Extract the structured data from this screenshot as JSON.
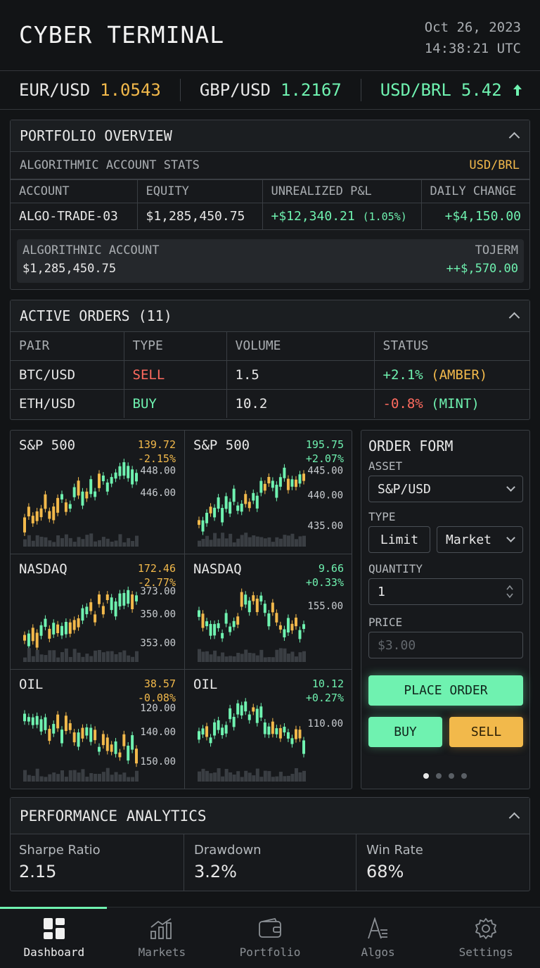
{
  "header": {
    "title": "CYBER TERMINAL",
    "date": "Oct 26, 2023",
    "time": "14:38:21 UTC"
  },
  "ticker": [
    {
      "pair": "EUR/USD",
      "value": "1.0543",
      "color": "#f2b94b"
    },
    {
      "pair": "GBP/USD",
      "value": "1.2167",
      "color": "#6ff2b0"
    },
    {
      "pair": "USD/BRL",
      "value": "5.42",
      "color": "#6ff2b0",
      "arrow": "arrow-up-icon"
    }
  ],
  "portfolio": {
    "title": "PORTFOLIO OVERVIEW",
    "subtitle": "ALGORITHMIC ACCOUNT STATS",
    "subtitle_right": "USD/BRL",
    "columns": [
      "ACCOUNT",
      "EQUITY",
      "UNREALIZED P&L",
      "DAILY CHANGE"
    ],
    "row": {
      "account": "ALGO-TRADE-03",
      "equity": "$1,285,450.75",
      "pnl": "+$12,340.21",
      "pnl_pct": "(1.05%)",
      "daily": "+$4,150.00"
    },
    "card": {
      "label": "ALGORITHNIC ACCOUNT",
      "value": "$1,285,450.75",
      "right_label": "TOJERM",
      "right_value": "++$,570.00"
    }
  },
  "orders": {
    "title": "ACTIVE ORDERS (11)",
    "columns": [
      "PAIR",
      "TYPE",
      "VOLUME",
      "STATUS"
    ],
    "rows": [
      {
        "pair": "BTC/USD",
        "type": "SELL",
        "volume": "1.5",
        "status": "+2.1%",
        "status_tag": "(AMBER)"
      },
      {
        "pair": "ETH/USD",
        "type": "BUY",
        "volume": "10.2",
        "status": "-0.8%",
        "status_tag": "(MINT)"
      }
    ]
  },
  "markets": [
    {
      "name": "S&P 500",
      "price": "139.72",
      "change": "-2.15%",
      "ticks": [
        "448.00",
        "446.00"
      ],
      "trend": "up"
    },
    {
      "name": "S&P 500",
      "price": "195.75",
      "change": "+2.07%",
      "ticks": [
        "445.00",
        "440.00",
        "435.00"
      ],
      "trend": "up"
    },
    {
      "name": "NASDAQ",
      "price": "172.46",
      "change": "-2.77%",
      "ticks": [
        "373.00",
        "350.00",
        "353.00"
      ],
      "trend": "up"
    },
    {
      "name": "NASDAQ",
      "price": "9.66",
      "change": "+0.33%",
      "ticks": [
        "155.00"
      ],
      "trend": "mixed"
    },
    {
      "name": "OIL",
      "price": "38.57",
      "change": "-0.08%",
      "ticks": [
        "120.00",
        "140.00",
        "150.00"
      ],
      "trend": "down"
    },
    {
      "name": "OIL",
      "price": "10.12",
      "change": "+0.27%",
      "ticks": [
        "110.00"
      ],
      "trend": "vshape"
    }
  ],
  "order_form": {
    "title": "ORDER FORM",
    "asset_label": "ASSET",
    "asset_value": "S&P/USD",
    "type_label": "TYPE",
    "type_limit": "Limit",
    "type_market": "Market",
    "quantity_label": "QUANTITY",
    "quantity_value": "1",
    "price_label": "PRICE",
    "price_placeholder": "$3.00",
    "place_order": "PLACE ORDER",
    "buy": "BUY",
    "sell": "SELL",
    "page_count": 4,
    "active_page": 1
  },
  "analytics": {
    "title": "PERFORMANCE ANALYTICS",
    "metrics": [
      {
        "label": "Sharpe Ratio",
        "value": "2.15"
      },
      {
        "label": "Drawdown",
        "value": "3.2%"
      },
      {
        "label": "Win Rate",
        "value": "68%"
      }
    ]
  },
  "nav": [
    {
      "label": "Dashboard",
      "icon": "dashboard-icon",
      "active": true
    },
    {
      "label": "Markets",
      "icon": "markets-icon",
      "active": false
    },
    {
      "label": "Portfolio",
      "icon": "wallet-icon",
      "active": false
    },
    {
      "label": "Algos",
      "icon": "algos-icon",
      "active": false
    },
    {
      "label": "Settings",
      "icon": "gear-icon",
      "active": false
    }
  ],
  "colors": {
    "mint": "#6ff2b0",
    "amber": "#f2b94b",
    "red": "#ff6b5f",
    "bg": "#121416"
  }
}
